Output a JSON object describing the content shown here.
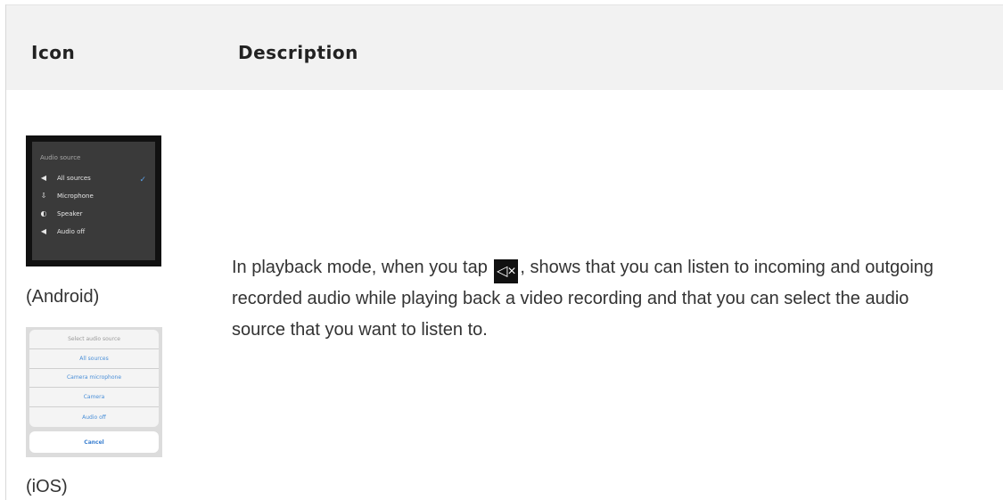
{
  "table": {
    "headers": {
      "icon": "Icon",
      "description": "Description"
    },
    "row": {
      "android_caption": "(Android)",
      "ios_caption": "(iOS)",
      "description_before": "In playback mode, when you tap ",
      "description_after": ", shows that you can listen to incoming and outgoing recorded audio while playing back a video recording and that you can select the audio source that you want to listen to.",
      "tap_icon": "speaker-mute-icon"
    }
  },
  "android_menu": {
    "title": "Audio source",
    "items": [
      {
        "label": "All sources",
        "icon": "speaker-icon",
        "selected": true
      },
      {
        "label": "Microphone",
        "icon": "microphone-icon",
        "selected": false
      },
      {
        "label": "Speaker",
        "icon": "speaker-alt-icon",
        "selected": false
      },
      {
        "label": "Audio off",
        "icon": "audio-off-icon",
        "selected": false
      }
    ]
  },
  "ios_menu": {
    "title": "Select audio source",
    "items": [
      "All sources",
      "Camera microphone",
      "Camera",
      "Audio off"
    ],
    "cancel": "Cancel"
  }
}
